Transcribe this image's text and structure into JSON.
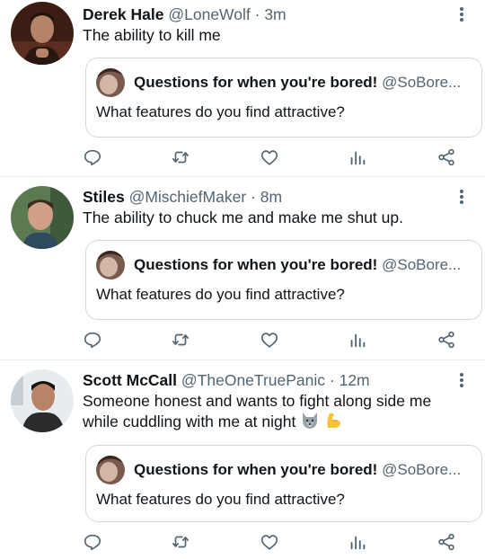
{
  "colors": {
    "text": "#0f1419",
    "muted": "#536471",
    "border": "#cfd9de",
    "divider": "#e6ecf0"
  },
  "tweets": [
    {
      "name": "Derek Hale",
      "handle": "@LoneWolf",
      "dot": "·",
      "time": "3m",
      "text": "The ability to kill me",
      "quote": {
        "name": "Questions for when you're bored!",
        "handle": "@SoBore...",
        "text": "What features do you find attractive?"
      }
    },
    {
      "name": "Stiles",
      "handle": "@MischiefMaker",
      "dot": "·",
      "time": "8m",
      "text": "The ability to chuck me and make me shut up.",
      "quote": {
        "name": "Questions for when you're bored!",
        "handle": "@SoBore...",
        "text": "What features do you find attractive?"
      }
    },
    {
      "name": "Scott McCall",
      "handle": "@TheOneTruePanic",
      "dot": "·",
      "time": "12m",
      "text_line1": "Someone honest and wants to fight along side me",
      "text_line2": "while cuddling with me at night",
      "emojis": [
        "wolf",
        "flexed-biceps"
      ],
      "quote": {
        "name": "Questions for when you're bored!",
        "handle": "@SoBore...",
        "text": "What features do you find attractive?"
      }
    }
  ],
  "icons": [
    "more-icon",
    "reply-icon",
    "retweet-icon",
    "like-icon",
    "analytics-icon",
    "share-icon"
  ]
}
